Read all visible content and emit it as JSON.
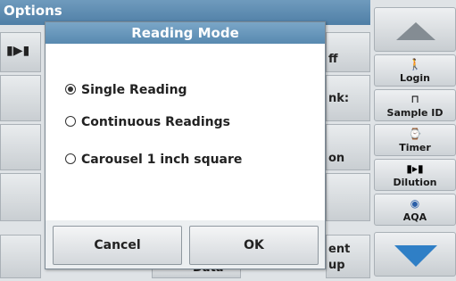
{
  "screen": {
    "title": "Options"
  },
  "background_fragments": {
    "row1_right": "ff",
    "row2_right": "nk:",
    "row3_right": "on",
    "row5_right_top": "ent",
    "row5_right_bottom": "up",
    "row5_mid": "Data"
  },
  "side": {
    "login": "Login",
    "sample_id": "Sample ID",
    "timer": "Timer",
    "dilution": "Dilution",
    "aqa": "AQA"
  },
  "dialog": {
    "title": "Reading Mode",
    "options": [
      {
        "label": "Single Reading",
        "selected": true
      },
      {
        "label": "Continuous Readings",
        "selected": false
      },
      {
        "label": "Carousel 1 inch square",
        "selected": false
      }
    ],
    "cancel": "Cancel",
    "ok": "OK"
  }
}
